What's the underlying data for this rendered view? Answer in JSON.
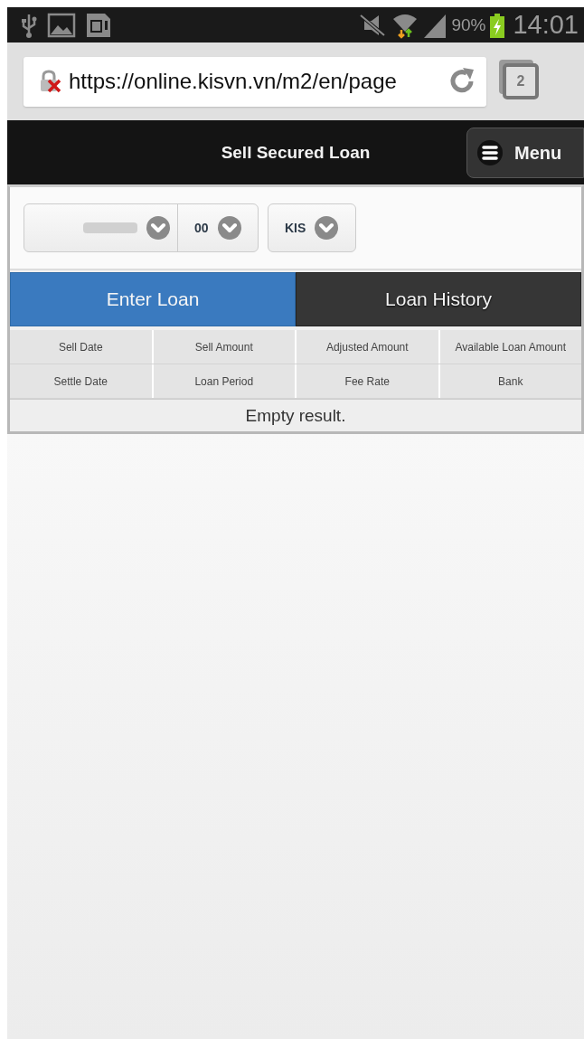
{
  "status_bar": {
    "battery": "90%",
    "time": "14:01"
  },
  "browser": {
    "url": "https://online.kisvn.vn/m2/en/page",
    "tab_count": "2"
  },
  "header": {
    "title": "Sell Secured Loan",
    "menu_button": "Menu"
  },
  "selectors": {
    "sub_account": "00",
    "broker": "KIS"
  },
  "tabs": [
    {
      "label": "Enter Loan",
      "selected": true
    },
    {
      "label": "Loan History",
      "selected": false
    }
  ],
  "table": {
    "header_rows": [
      [
        "Sell Date",
        "Sell Amount",
        "Adjusted Amount",
        "Available Loan Amount"
      ],
      [
        "Settle Date",
        "Loan Period",
        "Fee Rate",
        "Bank"
      ]
    ],
    "empty_message": "Empty result."
  }
}
